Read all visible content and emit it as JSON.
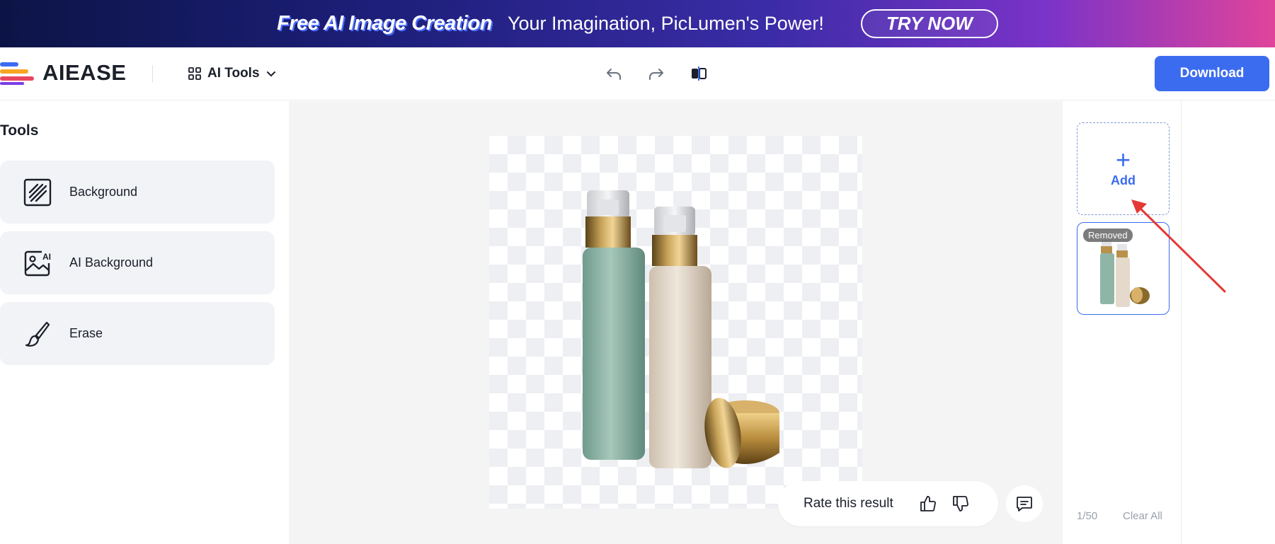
{
  "banner": {
    "title": "Free AI Image Creation",
    "subtitle": "Your Imagination, PicLumen's Power!",
    "cta": "TRY NOW"
  },
  "header": {
    "logo": "AIEASE",
    "ai_tools": "AI Tools",
    "download": "Download",
    "icons": [
      "undo-icon",
      "redo-icon",
      "compare-icon"
    ]
  },
  "tools": {
    "title": "Tools",
    "items": [
      {
        "label": "Background",
        "icon": "background-hatch-icon"
      },
      {
        "label": "AI Background",
        "icon": "ai-background-icon"
      },
      {
        "label": "Erase",
        "icon": "brush-icon"
      }
    ]
  },
  "canvas": {
    "rate_text": "Rate this result"
  },
  "history": {
    "add_label": "Add",
    "badge": "Removed",
    "count": "1/50",
    "clear_all": "Clear All"
  },
  "colors": {
    "accent": "#3b6cf0",
    "tool_card_bg": "#f1f3f6",
    "canvas_bg": "#f4f4f5",
    "arrow": "#e53935"
  }
}
